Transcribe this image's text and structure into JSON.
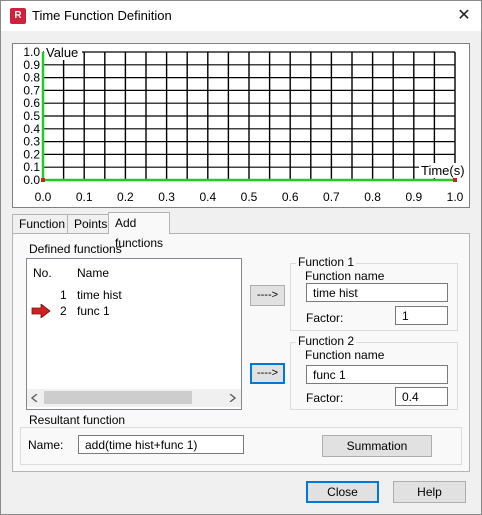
{
  "window": {
    "title": "Time Function Definition",
    "app_icon_letter": "R",
    "close_glyph": "✕"
  },
  "chart_data": {
    "type": "line",
    "ylabel": "Value",
    "xlabel": "Time(s)",
    "x_ticks": [
      "0.0",
      "0.1",
      "0.2",
      "0.3",
      "0.4",
      "0.5",
      "0.6",
      "0.7",
      "0.8",
      "0.9",
      "1.0"
    ],
    "y_ticks": [
      "0.0",
      "0.1",
      "0.2",
      "0.3",
      "0.4",
      "0.5",
      "0.6",
      "0.7",
      "0.8",
      "0.9",
      "1.0"
    ],
    "xlim": [
      0,
      1
    ],
    "ylim": [
      0,
      1
    ],
    "grid": true,
    "line_color": "#22cc22",
    "series": [
      {
        "x": [
          0,
          0,
          1
        ],
        "y": [
          1,
          0,
          0
        ]
      }
    ],
    "markers": [
      {
        "x": 0,
        "y": 0
      },
      {
        "x": 1,
        "y": 0
      }
    ]
  },
  "tabs": [
    "Function",
    "Points",
    "Add functions"
  ],
  "defined_functions": {
    "label": "Defined functions",
    "columns": [
      "No.",
      "Name"
    ],
    "rows": [
      {
        "no": "1",
        "name": "time hist",
        "selected": false
      },
      {
        "no": "2",
        "name": "func 1",
        "selected": true
      }
    ]
  },
  "arrow_label": "---->",
  "function1": {
    "group": "Function 1",
    "name_label": "Function name",
    "name_value": "time hist",
    "factor_label": "Factor:",
    "factor_value": "1"
  },
  "function2": {
    "group": "Function 2",
    "name_label": "Function name",
    "name_value": "func 1",
    "factor_label": "Factor:",
    "factor_value": "0.4"
  },
  "resultant": {
    "group": "Resultant function",
    "name_label": "Name:",
    "name_value": "add(time hist+func 1)",
    "button": "Summation"
  },
  "buttons": {
    "close": "Close",
    "help": "Help"
  },
  "colors": {
    "accent": "#0078d7",
    "plot_line": "#22cc22",
    "marker": "#cc2222",
    "arrow": "#cc2222"
  }
}
